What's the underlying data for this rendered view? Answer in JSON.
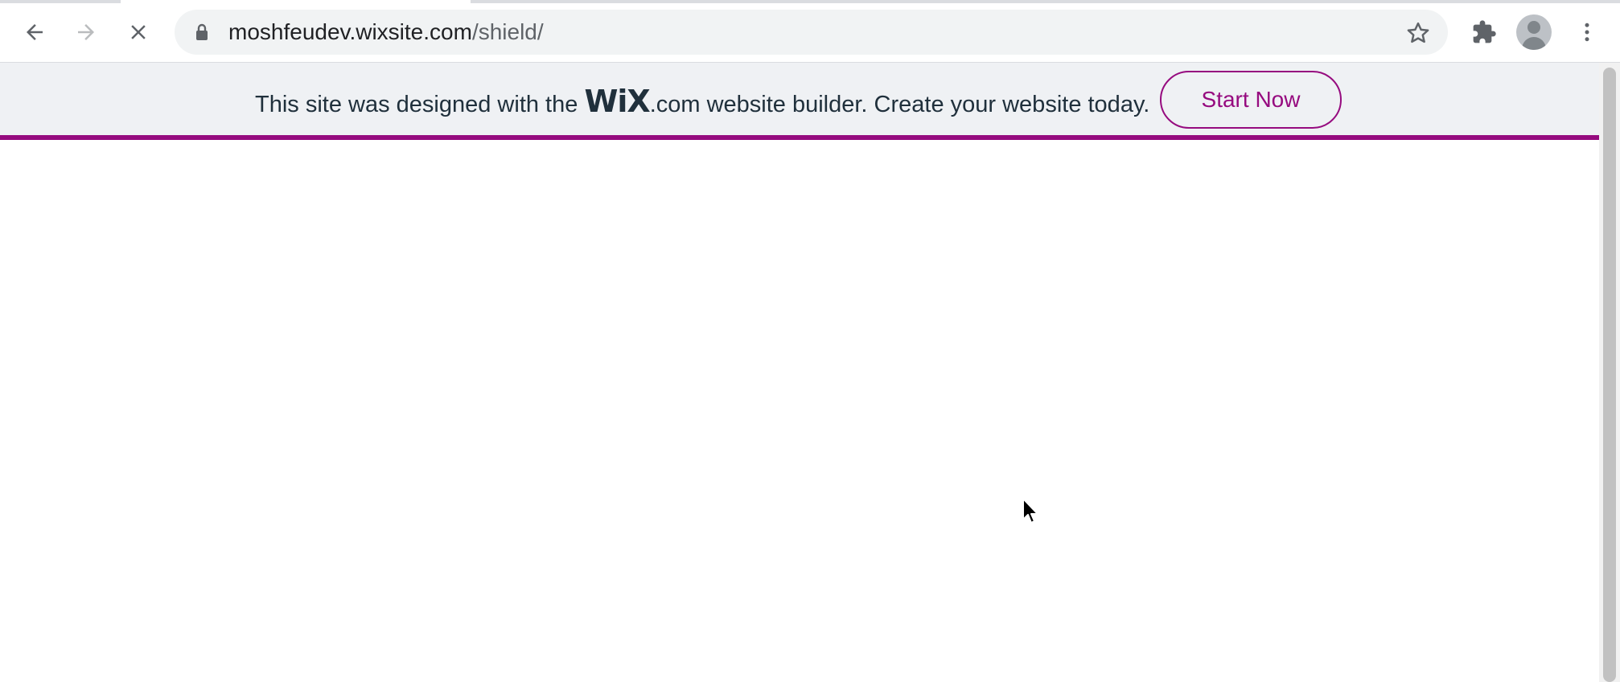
{
  "browser": {
    "back_icon": "back-arrow-icon",
    "forward_icon": "forward-arrow-icon",
    "stop_icon": "close-icon",
    "address_bar": {
      "lock_icon": "lock-icon",
      "url_host": "moshfeudev.wixsite.com",
      "url_path": "/shield/",
      "bookmark_icon": "star-icon"
    },
    "extensions_icon": "puzzle-icon",
    "profile_icon": "avatar-icon",
    "menu_icon": "kebab-menu-icon"
  },
  "wix_banner": {
    "text_before_logo": "This site was designed with the ",
    "logo_text": "WiX",
    "text_after_logo": ".com website builder. Create your website today.",
    "cta_label": "Start Now",
    "accent_color": "#960b7f",
    "background_color": "#eff1f4"
  }
}
